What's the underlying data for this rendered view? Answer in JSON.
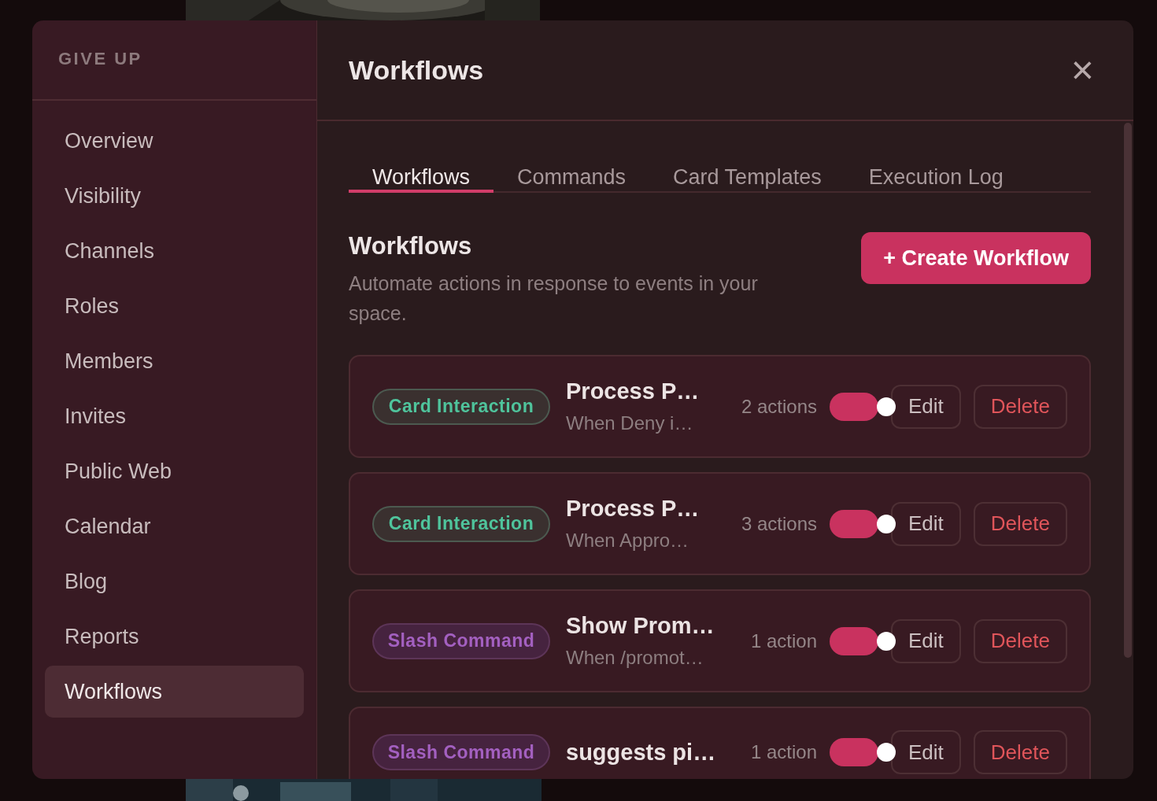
{
  "sidebar": {
    "heading": "GIVE UP",
    "items": [
      {
        "label": "Overview",
        "selected": false
      },
      {
        "label": "Visibility",
        "selected": false
      },
      {
        "label": "Channels",
        "selected": false
      },
      {
        "label": "Roles",
        "selected": false
      },
      {
        "label": "Members",
        "selected": false
      },
      {
        "label": "Invites",
        "selected": false
      },
      {
        "label": "Public Web",
        "selected": false
      },
      {
        "label": "Calendar",
        "selected": false
      },
      {
        "label": "Blog",
        "selected": false
      },
      {
        "label": "Reports",
        "selected": false
      },
      {
        "label": "Workflows",
        "selected": true
      }
    ]
  },
  "dialog": {
    "title": "Workflows",
    "close": "×"
  },
  "tabs": [
    {
      "label": "Workflows",
      "selected": true
    },
    {
      "label": "Commands",
      "selected": false
    },
    {
      "label": "Card Templates",
      "selected": false
    },
    {
      "label": "Execution Log",
      "selected": false
    }
  ],
  "section": {
    "title": "Workflows",
    "description": "Automate actions in response to events in your space.",
    "create_button": "+ Create Workflow"
  },
  "workflows": [
    {
      "trigger": "Card Interaction",
      "kind": "card",
      "name": "Process P…",
      "subtitle": "When Deny i…",
      "actions": "2 actions",
      "on": true,
      "edit": "Edit",
      "delete": "Delete"
    },
    {
      "trigger": "Card Interaction",
      "kind": "card",
      "name": "Process P…",
      "subtitle": "When Appro…",
      "actions": "3 actions",
      "on": true,
      "edit": "Edit",
      "delete": "Delete"
    },
    {
      "trigger": "Slash Command",
      "kind": "slash",
      "name": "Show Prom…",
      "subtitle": "When /promot…",
      "actions": "1 action",
      "on": true,
      "edit": "Edit",
      "delete": "Delete"
    },
    {
      "trigger": "Slash Command",
      "kind": "slash",
      "name": "suggests pi…",
      "actions": "1 action",
      "on": true,
      "edit": "Edit",
      "delete": "Delete"
    }
  ]
}
